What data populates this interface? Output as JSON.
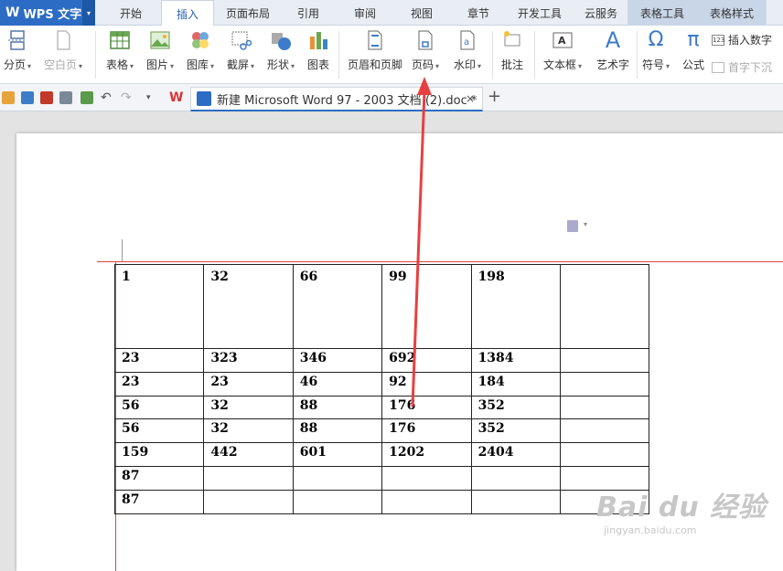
{
  "app": {
    "name": "WPS 文字"
  },
  "menu_tabs": [
    {
      "label": "开始"
    },
    {
      "label": "插入"
    },
    {
      "label": "页面布局"
    },
    {
      "label": "引用"
    },
    {
      "label": "审阅"
    },
    {
      "label": "视图"
    },
    {
      "label": "章节"
    },
    {
      "label": "开发工具"
    },
    {
      "label": "云服务"
    },
    {
      "label": "表格工具"
    },
    {
      "label": "表格样式"
    }
  ],
  "ribbon": {
    "page_break": "分页",
    "blank_page": "空白页",
    "table": "表格",
    "picture": "图片",
    "gallery": "图库",
    "screenshot": "截屏",
    "shape": "形状",
    "chart": "图表",
    "header_footer": "页眉和页脚",
    "page_number": "页码",
    "watermark": "水印",
    "comment": "批注",
    "textbox": "文本框",
    "wordart": "艺术字",
    "symbol": "符号",
    "formula": "公式",
    "insert_number": "插入数字",
    "drop_cap": "首字下沉",
    "insert_number_icon_text": "123",
    "symbol_glyph": "Ω",
    "formula_glyph": "π",
    "wordart_glyph": "A"
  },
  "document": {
    "tab_title": "新建 Microsoft Word 97 - 2003 文档 (2).doc *",
    "close_glyph": "×",
    "new_tab_glyph": "+"
  },
  "table": {
    "rows": [
      [
        "1",
        "32",
        "66",
        "99",
        "198",
        ""
      ],
      [
        "23",
        "323",
        "346",
        "692",
        "1384",
        ""
      ],
      [
        "23",
        "23",
        "46",
        "92",
        "184",
        ""
      ],
      [
        "56",
        "32",
        "88",
        "176",
        "352",
        ""
      ],
      [
        "56",
        "32",
        "88",
        "176",
        "352",
        ""
      ],
      [
        "159",
        "442",
        "601",
        "1202",
        "2404",
        ""
      ],
      [
        "87",
        "",
        "",
        "",
        "",
        ""
      ],
      [
        "87",
        "",
        "",
        "",
        "",
        ""
      ]
    ]
  },
  "watermark": {
    "main": "Bai du 经验",
    "sub": "jingyan.baidu.com"
  },
  "colors": {
    "accent": "#2c6cc4",
    "arrow": "#e84040",
    "margin_line": "#dd4444"
  },
  "icons": {
    "wps_logo": "W",
    "dropdown": "▾"
  }
}
